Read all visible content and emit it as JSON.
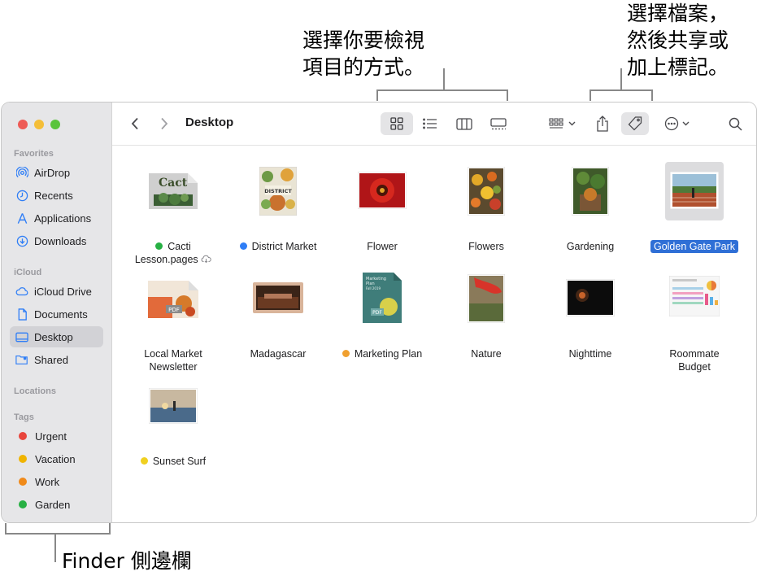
{
  "callouts": {
    "view_line1": "選擇你要檢視",
    "view_line2": "項目的方式。",
    "share_line1": "選擇檔案，",
    "share_line2": "然後共享或",
    "share_line3": "加上標記。",
    "sidebar_caption": "Finder 側邊欄"
  },
  "toolbar": {
    "title": "Desktop"
  },
  "sidebar": {
    "favorites_header": "Favorites",
    "favorites": [
      {
        "label": "AirDrop",
        "icon": "airdrop-icon"
      },
      {
        "label": "Recents",
        "icon": "clock-icon"
      },
      {
        "label": "Applications",
        "icon": "applications-icon"
      },
      {
        "label": "Downloads",
        "icon": "download-icon"
      }
    ],
    "icloud_header": "iCloud",
    "icloud": [
      {
        "label": "iCloud Drive",
        "icon": "cloud-icon"
      },
      {
        "label": "Documents",
        "icon": "document-icon"
      },
      {
        "label": "Desktop",
        "icon": "desktop-icon",
        "selected": true
      },
      {
        "label": "Shared",
        "icon": "shared-folder-icon"
      }
    ],
    "locations_header": "Locations",
    "tags_header": "Tags",
    "tags": [
      {
        "label": "Urgent",
        "color": "#e8453c"
      },
      {
        "label": "Vacation",
        "color": "#f0b400"
      },
      {
        "label": "Work",
        "color": "#f08a1a"
      },
      {
        "label": "Garden",
        "color": "#27b043"
      }
    ]
  },
  "files": [
    {
      "line1": "Cacti",
      "line2": "Lesson.pages",
      "tag_color": "#27b043",
      "thumb_text": "Cact",
      "cloud": true
    },
    {
      "line1": "District Market",
      "line2": "",
      "tag_color": "#2f7ef6",
      "thumb_text": "DISTRICT"
    },
    {
      "line1": "Flower",
      "line2": ""
    },
    {
      "line1": "Flowers",
      "line2": ""
    },
    {
      "line1": "Gardening",
      "line2": ""
    },
    {
      "line1": "Golden Gate Park",
      "line2": "",
      "selected": true
    },
    {
      "line1": "Local Market",
      "line2": "Newsletter",
      "badge": "PDF"
    },
    {
      "line1": "Madagascar",
      "line2": ""
    },
    {
      "line1": "Marketing Plan",
      "line2": "",
      "tag_color": "#f0a030",
      "badge": "PDF",
      "thumb_text": "Marketing Plan Fall 2019"
    },
    {
      "line1": "Nature",
      "line2": ""
    },
    {
      "line1": "Nighttime",
      "line2": ""
    },
    {
      "line1": "Roommate",
      "line2": "Budget"
    },
    {
      "line1": "Sunset Surf",
      "line2": "",
      "tag_color": "#f0d020"
    }
  ]
}
